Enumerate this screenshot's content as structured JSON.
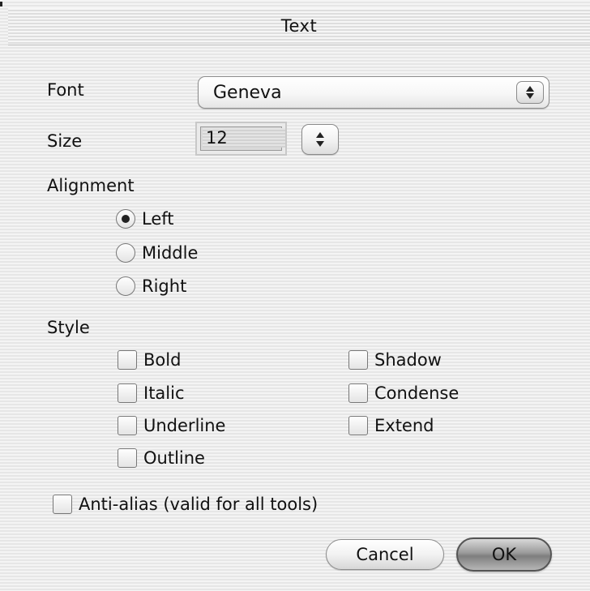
{
  "dialog": {
    "title": "Text",
    "font": {
      "label": "Font",
      "value": "Geneva"
    },
    "size": {
      "label": "Size",
      "value": "12"
    },
    "alignment": {
      "label": "Alignment",
      "options": [
        "Left",
        "Middle",
        "Right"
      ],
      "selected": "Left"
    },
    "style": {
      "label": "Style",
      "left_column": [
        "Bold",
        "Italic",
        "Underline",
        "Outline"
      ],
      "right_column": [
        "Shadow",
        "Condense",
        "Extend"
      ]
    },
    "anti_alias": {
      "label": "Anti-alias (valid for all tools)",
      "checked": false
    },
    "buttons": {
      "cancel": "Cancel",
      "ok": "OK"
    }
  },
  "colors": {
    "background": "#ededed",
    "text": "#111111",
    "default_button": "#8f8f8f"
  },
  "icons": [
    "popup-stepper-icon",
    "size-stepper-icon"
  ]
}
